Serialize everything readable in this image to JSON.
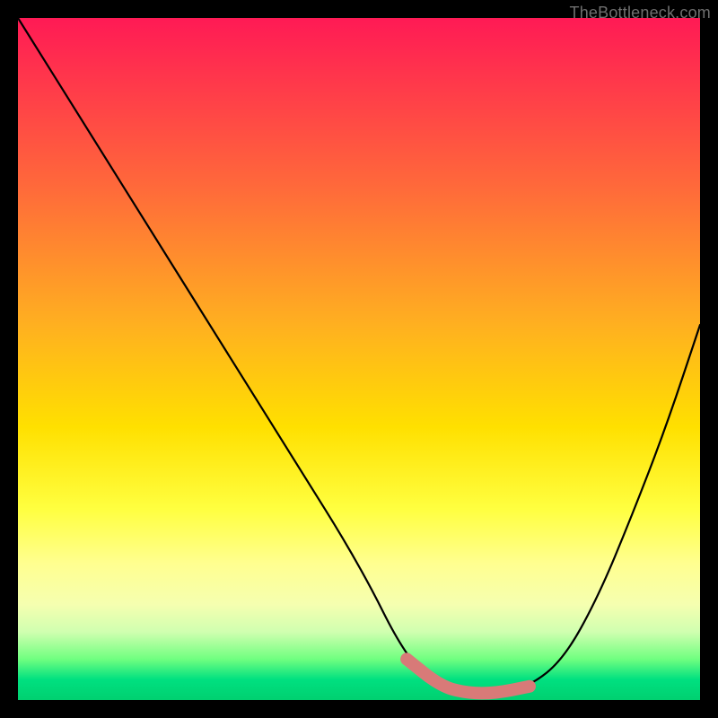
{
  "attribution": "TheBottleneck.com",
  "chart_data": {
    "type": "line",
    "title": "",
    "xlabel": "",
    "ylabel": "",
    "xlim": [
      0,
      100
    ],
    "ylim": [
      0,
      100
    ],
    "background": "rainbow-vertical-gradient",
    "series": [
      {
        "name": "bottleneck-curve",
        "color": "#000000",
        "x": [
          0,
          10,
          20,
          30,
          40,
          50,
          57,
          62,
          66,
          70,
          75,
          80,
          85,
          90,
          95,
          100
        ],
        "y": [
          100,
          84,
          68,
          52,
          36,
          20,
          6,
          2,
          1,
          1,
          2,
          6,
          15,
          27,
          40,
          55
        ]
      },
      {
        "name": "highlight-band",
        "color": "#d87a78",
        "x": [
          57,
          62,
          66,
          70,
          75
        ],
        "y": [
          6,
          2,
          1,
          1,
          2
        ]
      }
    ],
    "annotations": []
  }
}
